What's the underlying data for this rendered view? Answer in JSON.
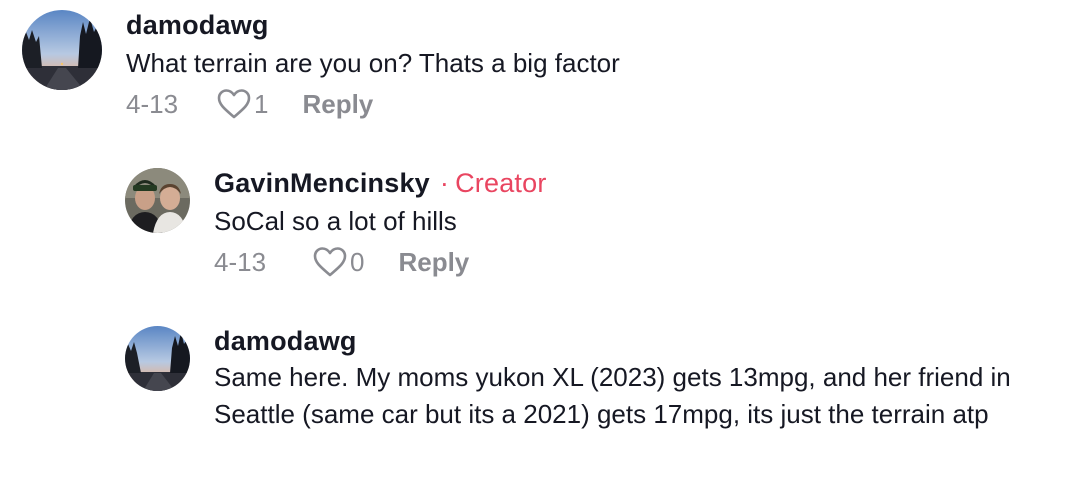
{
  "comments": [
    {
      "username": "damodawg",
      "text": "What terrain are you on? Thats a big factor",
      "date": "4-13",
      "likes": "1",
      "reply_label": "Reply",
      "avatar": "night-road-photo"
    },
    {
      "username": "GavinMencinsky",
      "badge_dot": "·",
      "badge": "Creator",
      "text": "SoCal so a lot of hills",
      "date": "4-13",
      "likes": "0",
      "reply_label": "Reply",
      "avatar": "two-people-photo"
    },
    {
      "username": "damodawg",
      "text": "Same here. My moms yukon XL (2023) gets 13mpg, and her friend in Seattle (same car but its a 2021) gets 17mpg, its just the terrain atp",
      "avatar": "night-road-photo"
    }
  ],
  "colors": {
    "creator_badge": "#e94560",
    "meta_text": "#8a8b91",
    "primary_text": "#161823"
  },
  "icons": {
    "like": "heart-outline-icon"
  }
}
